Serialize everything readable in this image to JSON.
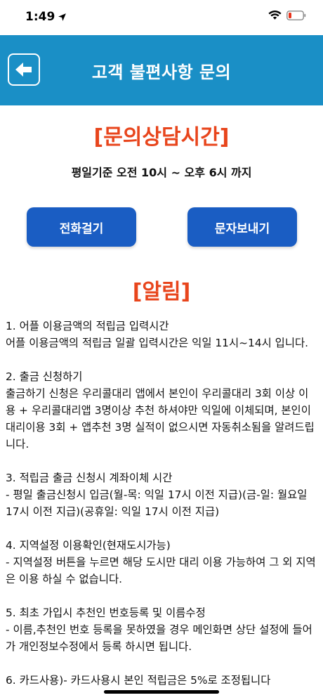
{
  "status": {
    "time": "1:49"
  },
  "nav": {
    "title": "고객 불편사항 문의"
  },
  "consult": {
    "heading": "[문의상담시간]",
    "hours": "평일기준 오전 10시 ~ 오후 6시 까지",
    "call_label": "전화걸기",
    "sms_label": "문자보내기"
  },
  "notice": {
    "heading": "[알림]",
    "items": [
      {
        "title": "1. 어플 이용금액의 적립금 입력시간",
        "body": "어플 이용금액의 적립금 일괄 입력시간은 익일 11시~14시 입니다."
      },
      {
        "title": "2. 출금 신청하기",
        "body": "출금하기 신청은 우리콜대리 앱에서 본인이 우리콜대리 3회 이상 이용 + 우리콜대리앱 3명이상 추천 하셔야만 익일에 이체되며, 본인이 대리이용 3회 + 앱추천 3명 실적이 없으시면 자동취소됨을 알려드립니다."
      },
      {
        "title": "3. 적립금 출금 신청시 계좌이체 시간",
        "body": "- 평일 출금신청시 입금(월-목: 익일 17시 이전 지급)(금-일: 월요일 17시 이전 지급)(공휴일: 익일 17시 이전 지급)"
      },
      {
        "title": "4. 지역설정 이용확인(현재도시가능)",
        "body": "- 지역설정 버튼을 누르면 해당 도시만 대리 이용 가능하여 그 외 지역은 이용 하실 수 없습니다."
      },
      {
        "title": "5. 최초 가입시 추천인 번호등록 및 이름수정",
        "body": "- 이름,추천인 번호 등록을 못하였을 경우 메인화면 상단 설정에 들어가 개인정보수정에서 등록 하시면 됩니다."
      },
      {
        "title": "6. 카드사용)- 카드사용시 본인 적립금은 5%로 조정됩니다",
        "body": ""
      }
    ]
  }
}
